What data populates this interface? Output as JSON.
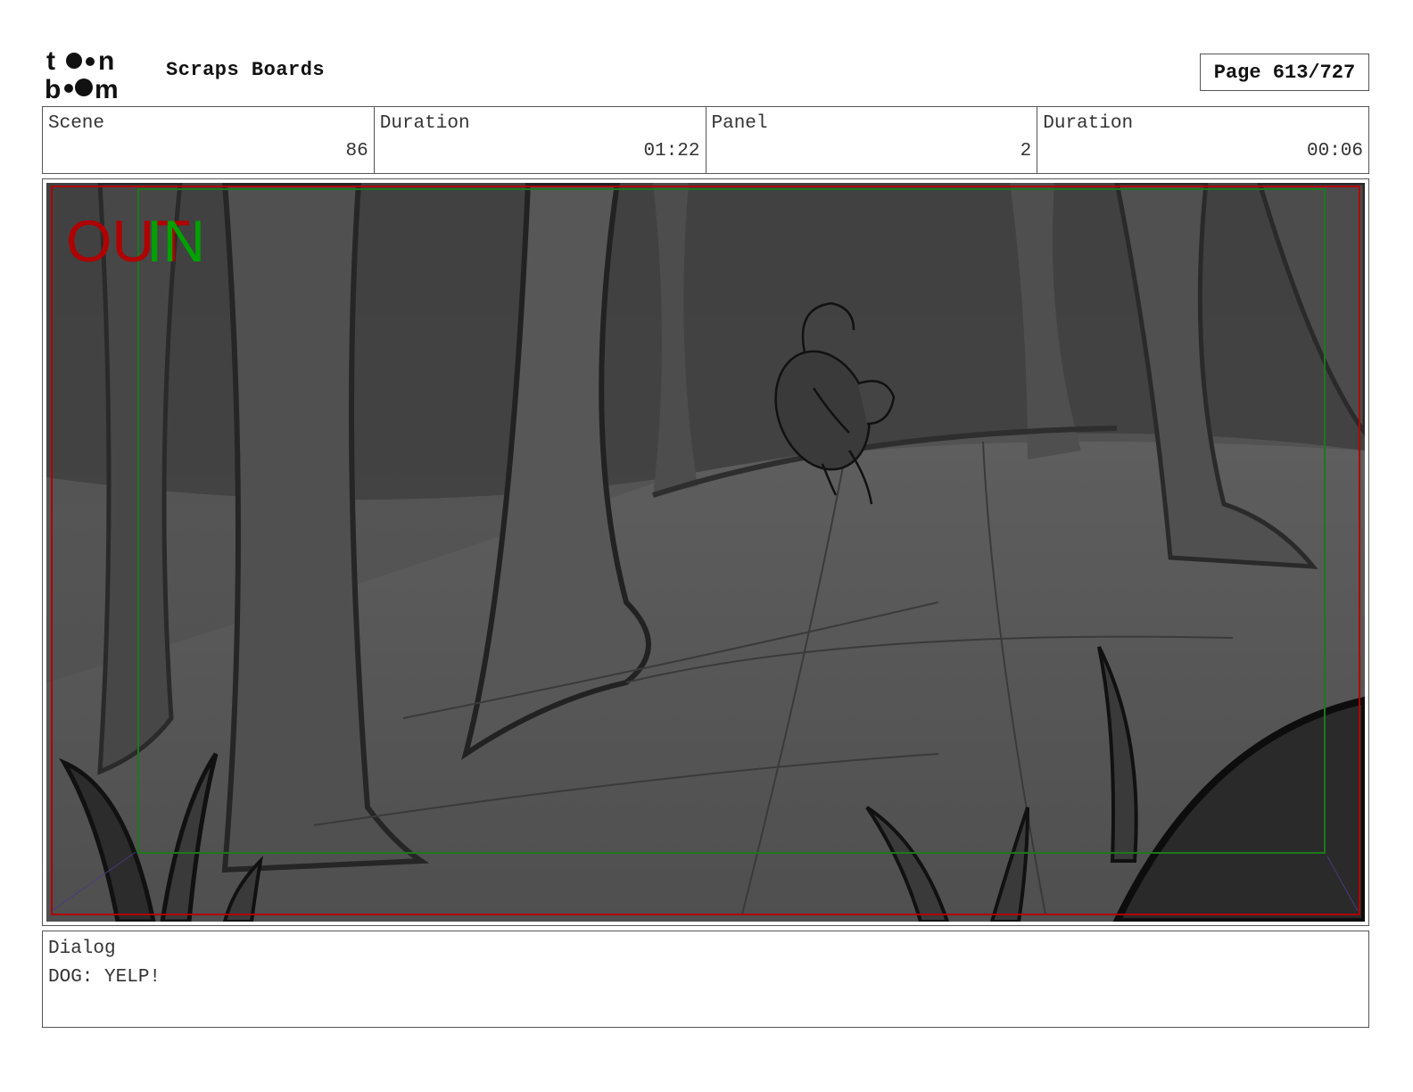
{
  "header": {
    "logo_text": "toon boom",
    "title": "Scraps Boards",
    "page": "Page 613/727"
  },
  "info": {
    "scene_label": "Scene",
    "scene_value": "86",
    "scene_duration_label": "Duration",
    "scene_duration_value": "01:22",
    "panel_label": "Panel",
    "panel_value": "2",
    "panel_duration_label": "Duration",
    "panel_duration_value": "00:06"
  },
  "panel": {
    "out_label": "OUT",
    "in_label": "IN",
    "out_color": "#b00000",
    "in_color": "#00a000",
    "safe_frame_color": "#1a7a1a",
    "camera_frame_color": "#b00000"
  },
  "dialog": {
    "label": "Dialog",
    "text": "DOG: YELP!"
  }
}
